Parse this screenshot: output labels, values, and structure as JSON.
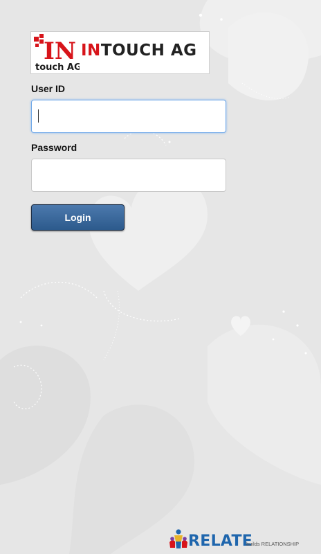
{
  "brand": {
    "logo_mark_top": "IN",
    "logo_mark_bottom": "touch AG",
    "logo_text_part1": "IN",
    "logo_text_part2": "TOUCH AG"
  },
  "form": {
    "user_id_label": "User ID",
    "user_id_value": "",
    "password_label": "Password",
    "password_value": "",
    "login_label": "Login"
  },
  "footer": {
    "relate_word": "RELATE",
    "relate_tagline": "builds RELATIONSHIP"
  },
  "colors": {
    "brand_red": "#d7141a",
    "button_blue": "#3a679c",
    "relate_blue": "#1f66ad",
    "background": "#e9e9e9"
  }
}
